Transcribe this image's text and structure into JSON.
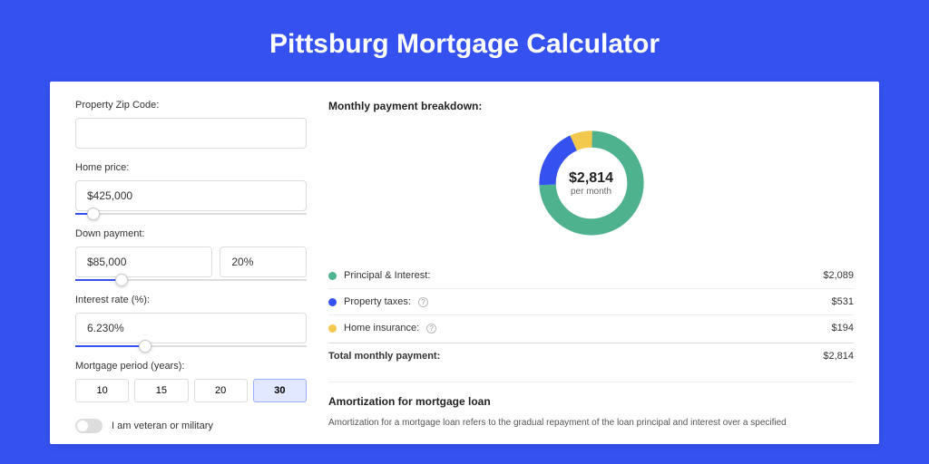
{
  "title": "Pittsburg Mortgage Calculator",
  "form": {
    "zip_label": "Property Zip Code:",
    "zip_value": "",
    "home_label": "Home price:",
    "home_value": "$425,000",
    "home_slider_pct": 8,
    "down_label": "Down payment:",
    "down_value": "$85,000",
    "down_pct": "20%",
    "down_slider_pct": 20,
    "rate_label": "Interest rate (%):",
    "rate_value": "6.230%",
    "rate_slider_pct": 30,
    "period_label": "Mortgage period (years):",
    "periods": [
      "10",
      "15",
      "20",
      "30"
    ],
    "period_active": "30",
    "veteran_label": "I am veteran or military"
  },
  "breakdown": {
    "title": "Monthly payment breakdown:",
    "center_value": "$2,814",
    "center_sub": "per month",
    "rows": [
      {
        "label": "Principal & Interest:",
        "value": "$2,089",
        "color": "#4fb28f",
        "help": false
      },
      {
        "label": "Property taxes:",
        "value": "$531",
        "color": "#3552f0",
        "help": true
      },
      {
        "label": "Home insurance:",
        "value": "$194",
        "color": "#f2c94c",
        "help": true
      }
    ],
    "total_label": "Total monthly payment:",
    "total_value": "$2,814"
  },
  "amort": {
    "title": "Amortization for mortgage loan",
    "text": "Amortization for a mortgage loan refers to the gradual repayment of the loan principal and interest over a specified"
  },
  "chart_data": {
    "type": "pie",
    "title": "Monthly payment breakdown",
    "series": [
      {
        "name": "Principal & Interest",
        "value": 2089,
        "color": "#4fb28f"
      },
      {
        "name": "Property taxes",
        "value": 531,
        "color": "#3552f0"
      },
      {
        "name": "Home insurance",
        "value": 194,
        "color": "#f2c94c"
      }
    ],
    "total": 2814
  }
}
